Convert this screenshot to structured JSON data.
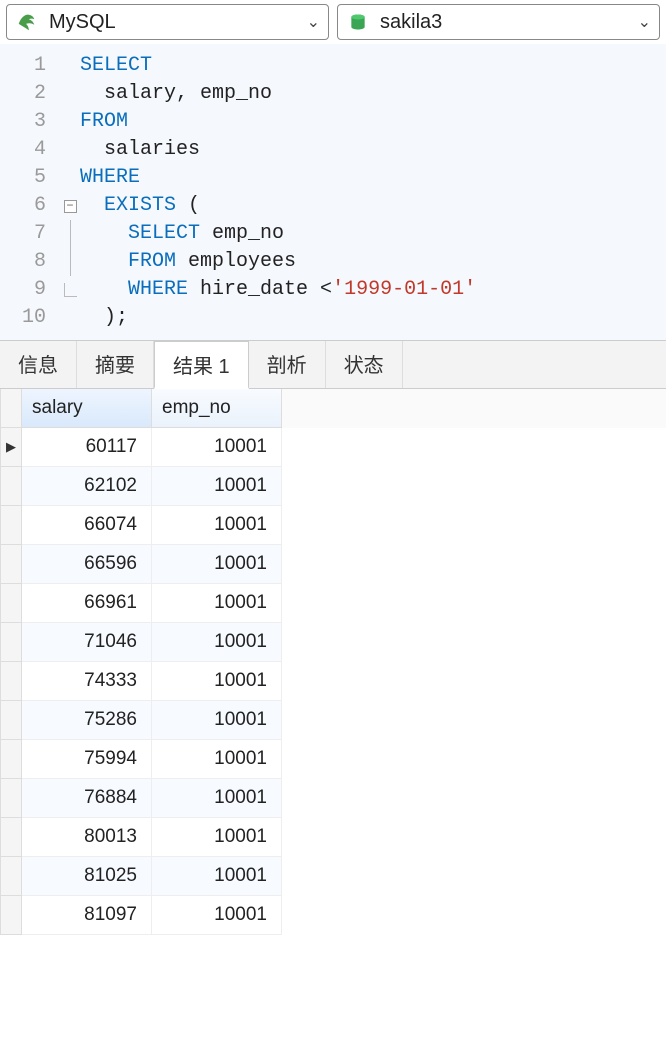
{
  "toolbar": {
    "connection": "MySQL",
    "database": "sakila3"
  },
  "editor": {
    "lines": [
      {
        "n": 1,
        "fold": "",
        "tokens": [
          [
            "kw",
            "SELECT"
          ]
        ]
      },
      {
        "n": 2,
        "fold": "",
        "tokens": [
          [
            "",
            "  salary, emp_no"
          ]
        ]
      },
      {
        "n": 3,
        "fold": "",
        "tokens": [
          [
            "kw",
            "FROM"
          ]
        ]
      },
      {
        "n": 4,
        "fold": "",
        "tokens": [
          [
            "",
            "  salaries"
          ]
        ]
      },
      {
        "n": 5,
        "fold": "",
        "tokens": [
          [
            "kw",
            "WHERE"
          ]
        ]
      },
      {
        "n": 6,
        "fold": "open",
        "tokens": [
          [
            "",
            "  "
          ],
          [
            "kw",
            "EXISTS"
          ],
          [
            "",
            " ("
          ]
        ]
      },
      {
        "n": 7,
        "fold": "mid",
        "tokens": [
          [
            "",
            "    "
          ],
          [
            "kw",
            "SELECT"
          ],
          [
            "",
            " emp_no"
          ]
        ]
      },
      {
        "n": 8,
        "fold": "mid",
        "tokens": [
          [
            "",
            "    "
          ],
          [
            "kw",
            "FROM"
          ],
          [
            "",
            " employees"
          ]
        ]
      },
      {
        "n": 9,
        "fold": "end",
        "tokens": [
          [
            "",
            "    "
          ],
          [
            "kw",
            "WHERE"
          ],
          [
            "",
            " hire_date <"
          ],
          [
            "str",
            "'1999-01-01'"
          ]
        ]
      },
      {
        "n": 10,
        "fold": "",
        "tokens": [
          [
            "",
            "  );"
          ]
        ]
      }
    ]
  },
  "tabs": {
    "items": [
      "信息",
      "摘要",
      "结果 1",
      "剖析",
      "状态"
    ],
    "active_index": 2
  },
  "results": {
    "columns": [
      "salary",
      "emp_no"
    ],
    "rows": [
      [
        60117,
        10001
      ],
      [
        62102,
        10001
      ],
      [
        66074,
        10001
      ],
      [
        66596,
        10001
      ],
      [
        66961,
        10001
      ],
      [
        71046,
        10001
      ],
      [
        74333,
        10001
      ],
      [
        75286,
        10001
      ],
      [
        75994,
        10001
      ],
      [
        76884,
        10001
      ],
      [
        80013,
        10001
      ],
      [
        81025,
        10001
      ],
      [
        81097,
        10001
      ]
    ],
    "current_row_index": 0
  }
}
